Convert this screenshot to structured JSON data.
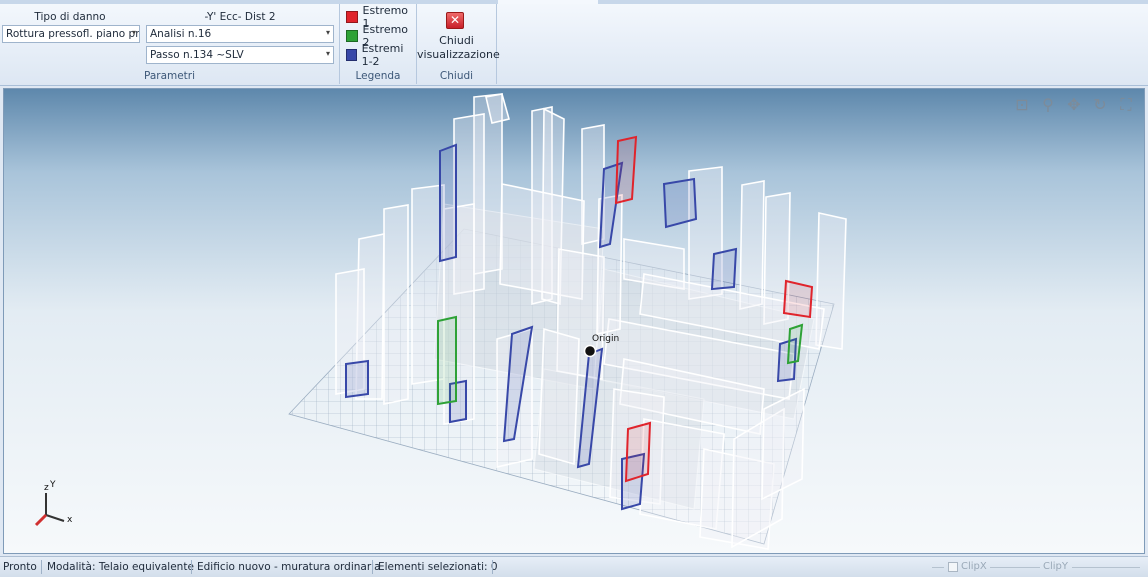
{
  "ribbon": {
    "group_parametri": {
      "tipo_label": "Tipo di danno",
      "tipo_value": "Rottura pressofl. piano pri",
      "analysis_label": "-Y' Ecc- Dist 2",
      "analisi_value": "Analisi n.16",
      "passo_value": "Passo n.134 ~SLV",
      "group_label": "Parametri"
    },
    "group_legenda": {
      "items": [
        {
          "label": "Estremo 1",
          "color": "#e0242c"
        },
        {
          "label": "Estremo 2",
          "color": "#2ea236"
        },
        {
          "label": "Estremi 1-2",
          "color": "#3848a8"
        }
      ],
      "group_label": "Legenda"
    },
    "group_chiudi": {
      "button_icon": "close-x-icon",
      "button_line1": "Chiudi",
      "button_line2": "visualizzazione",
      "group_label": "Chiudi"
    }
  },
  "viewport": {
    "origin_label": "Origin",
    "axis": {
      "z": "z",
      "y": "Y",
      "x": "x"
    },
    "toolbar": [
      "zoom-window-icon",
      "zoom-icon",
      "pan-icon",
      "rotate-icon",
      "fit-extents-icon"
    ]
  },
  "status": {
    "state": "Pronto",
    "mode": "Modalità: Telaio equivalente",
    "building": "Edificio nuovo - muratura ordinaria",
    "selected": "Elementi selezionati: 0",
    "clipx": "ClipX",
    "clipy": "ClipY"
  }
}
